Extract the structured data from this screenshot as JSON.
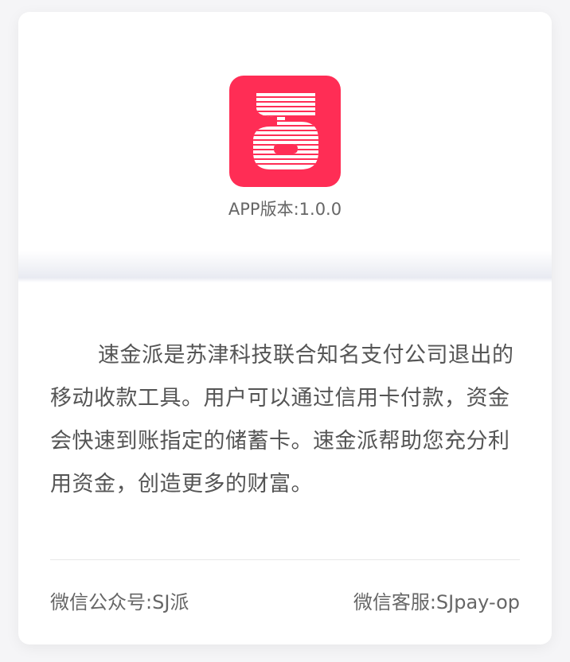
{
  "app": {
    "version_text": "APP版本:1.0.0",
    "logo_icon": "sjpay-logo-icon",
    "brand_color": "#ff2d55"
  },
  "about": {
    "description": "速金派是苏津科技联合知名支付公司退出的移动收款工具。用户可以通过信用卡付款，资金会快速到账指定的储蓄卡。速金派帮助您充分利用资金，创造更多的财富。"
  },
  "footer": {
    "wechat_official": "微信公众号:SJ派",
    "wechat_service": "微信客服:SJpay-op"
  }
}
